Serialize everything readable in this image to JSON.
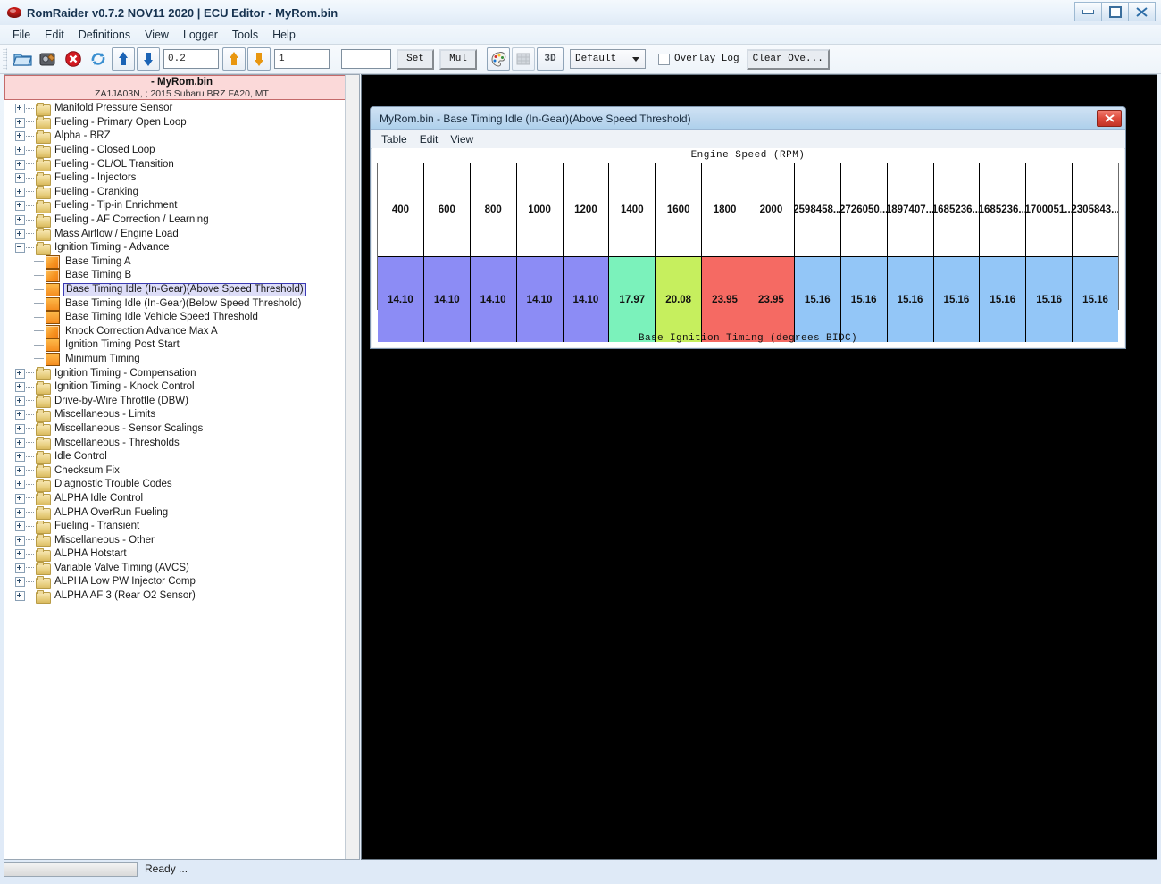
{
  "window": {
    "title": "RomRaider v0.7.2 NOV11 2020 | ECU Editor - MyRom.bin",
    "app_icon": "romraider-icon",
    "buttons": {
      "minimize": "minimize-icon",
      "maximize": "maximize-icon",
      "close": "close-icon"
    }
  },
  "menubar": {
    "items": [
      "File",
      "Edit",
      "Definitions",
      "View",
      "Logger",
      "Tools",
      "Help"
    ]
  },
  "toolbar": {
    "icons": [
      "open-image-icon",
      "save-image-icon",
      "close-image-icon",
      "refresh-image-icon"
    ],
    "coarse_up": "arrow-up-blue-icon",
    "coarse_down": "arrow-down-blue-icon",
    "coarse_value": "0.2",
    "fine_up": "arrow-up-orange-icon",
    "fine_down": "arrow-down-orange-icon",
    "fine_value": "1",
    "set_value": "",
    "set_label": "Set",
    "mul_label": "Mul",
    "palette_icon": "color-palette-icon",
    "compare_icon": "table-compare-icon",
    "three_d_label": "3D",
    "layout_selected": "Default",
    "layout_options": [
      "Default"
    ],
    "overlay_log_label": "Overlay Log",
    "overlay_log_checked": false,
    "clear_overlay_label": "Clear Ove..."
  },
  "sidebar": {
    "rom_name": "- MyRom.bin",
    "rom_subtitle": "ZA1JA03N, ; 2015 Subaru BRZ FA20, MT",
    "tree": [
      {
        "label": "Manifold Pressure Sensor",
        "type": "folder",
        "state": "collapsed"
      },
      {
        "label": "Fueling - Primary Open Loop",
        "type": "folder",
        "state": "collapsed"
      },
      {
        "label": "Alpha - BRZ",
        "type": "folder",
        "state": "collapsed"
      },
      {
        "label": "Fueling - Closed Loop",
        "type": "folder",
        "state": "collapsed"
      },
      {
        "label": "Fueling - CL/OL Transition",
        "type": "folder",
        "state": "collapsed"
      },
      {
        "label": "Fueling - Injectors",
        "type": "folder",
        "state": "collapsed"
      },
      {
        "label": "Fueling - Cranking",
        "type": "folder",
        "state": "collapsed"
      },
      {
        "label": "Fueling - Tip-in Enrichment",
        "type": "folder",
        "state": "collapsed"
      },
      {
        "label": "Fueling - AF Correction / Learning",
        "type": "folder",
        "state": "collapsed"
      },
      {
        "label": "Mass Airflow / Engine Load",
        "type": "folder",
        "state": "collapsed"
      },
      {
        "label": "Ignition Timing - Advance",
        "type": "folder",
        "state": "expanded"
      },
      {
        "label": "Base Timing A",
        "type": "table3d",
        "state": "child"
      },
      {
        "label": "Base Timing B",
        "type": "table3d",
        "state": "child"
      },
      {
        "label": "Base Timing Idle (In-Gear)(Above Speed Threshold)",
        "type": "table2d",
        "state": "child",
        "selected": true
      },
      {
        "label": "Base Timing Idle (In-Gear)(Below Speed Threshold)",
        "type": "table2d",
        "state": "child"
      },
      {
        "label": "Base Timing Idle Vehicle Speed Threshold",
        "type": "table2d",
        "state": "child"
      },
      {
        "label": "Knock Correction Advance Max A",
        "type": "table3d",
        "state": "child"
      },
      {
        "label": "Ignition Timing Post Start",
        "type": "table2d",
        "state": "child"
      },
      {
        "label": "Minimum Timing",
        "type": "table2d",
        "state": "child"
      },
      {
        "label": "Ignition Timing - Compensation",
        "type": "folder",
        "state": "collapsed"
      },
      {
        "label": "Ignition Timing - Knock Control",
        "type": "folder",
        "state": "collapsed"
      },
      {
        "label": "Drive-by-Wire Throttle (DBW)",
        "type": "folder",
        "state": "collapsed"
      },
      {
        "label": "Miscellaneous - Limits",
        "type": "folder",
        "state": "collapsed"
      },
      {
        "label": "Miscellaneous - Sensor Scalings",
        "type": "folder",
        "state": "collapsed"
      },
      {
        "label": "Miscellaneous - Thresholds",
        "type": "folder",
        "state": "collapsed"
      },
      {
        "label": "Idle Control",
        "type": "folder",
        "state": "collapsed"
      },
      {
        "label": "Checksum Fix",
        "type": "folder",
        "state": "collapsed"
      },
      {
        "label": "Diagnostic Trouble Codes",
        "type": "folder",
        "state": "collapsed"
      },
      {
        "label": "ALPHA Idle Control",
        "type": "folder",
        "state": "collapsed"
      },
      {
        "label": "ALPHA OverRun Fueling",
        "type": "folder",
        "state": "collapsed"
      },
      {
        "label": "Fueling - Transient",
        "type": "folder",
        "state": "collapsed"
      },
      {
        "label": "Miscellaneous - Other",
        "type": "folder",
        "state": "collapsed"
      },
      {
        "label": "ALPHA Hotstart",
        "type": "folder",
        "state": "collapsed"
      },
      {
        "label": "Variable Valve Timing (AVCS)",
        "type": "folder",
        "state": "collapsed"
      },
      {
        "label": "ALPHA Low PW Injector Comp",
        "type": "folder",
        "state": "collapsed"
      },
      {
        "label": "ALPHA AF 3 (Rear O2 Sensor)",
        "type": "folder",
        "state": "collapsed"
      }
    ]
  },
  "table_window": {
    "title": "MyRom.bin - Base Timing Idle (In-Gear)(Above Speed Threshold)",
    "close_label": "x",
    "menu": [
      "Table",
      "Edit",
      "View"
    ],
    "axis_title": "Engine Speed (RPM)",
    "bottom_label": "Base Ignition Timing (degrees BIDC)"
  },
  "chart_data": {
    "type": "table",
    "title": "Base Timing Idle (In-Gear)(Above Speed Threshold)",
    "xlabel": "Engine Speed (RPM)",
    "ylabel": "Base Ignition Timing (degrees BIDC)",
    "categories": [
      "400",
      "600",
      "800",
      "1000",
      "1200",
      "1400",
      "1600",
      "1800",
      "2000",
      "2598458...",
      "2726050...",
      "1897407...",
      "1685236...",
      "1685236...",
      "1700051...",
      "2305843..."
    ],
    "values": [
      "14.10",
      "14.10",
      "14.10",
      "14.10",
      "14.10",
      "17.97",
      "20.08",
      "23.95",
      "23.95",
      "15.16",
      "15.16",
      "15.16",
      "15.16",
      "15.16",
      "15.16",
      "15.16"
    ],
    "cell_colors": [
      "#8c8cf5",
      "#8c8cf5",
      "#8c8cf5",
      "#8c8cf5",
      "#8c8cf5",
      "#7bf2bb",
      "#c6ef5e",
      "#f56a63",
      "#f56a63",
      "#93c6f7",
      "#93c6f7",
      "#93c6f7",
      "#93c6f7",
      "#93c6f7",
      "#93c6f7",
      "#93c6f7"
    ]
  },
  "statusbar": {
    "progress_value": "",
    "status_text": "Ready ..."
  }
}
